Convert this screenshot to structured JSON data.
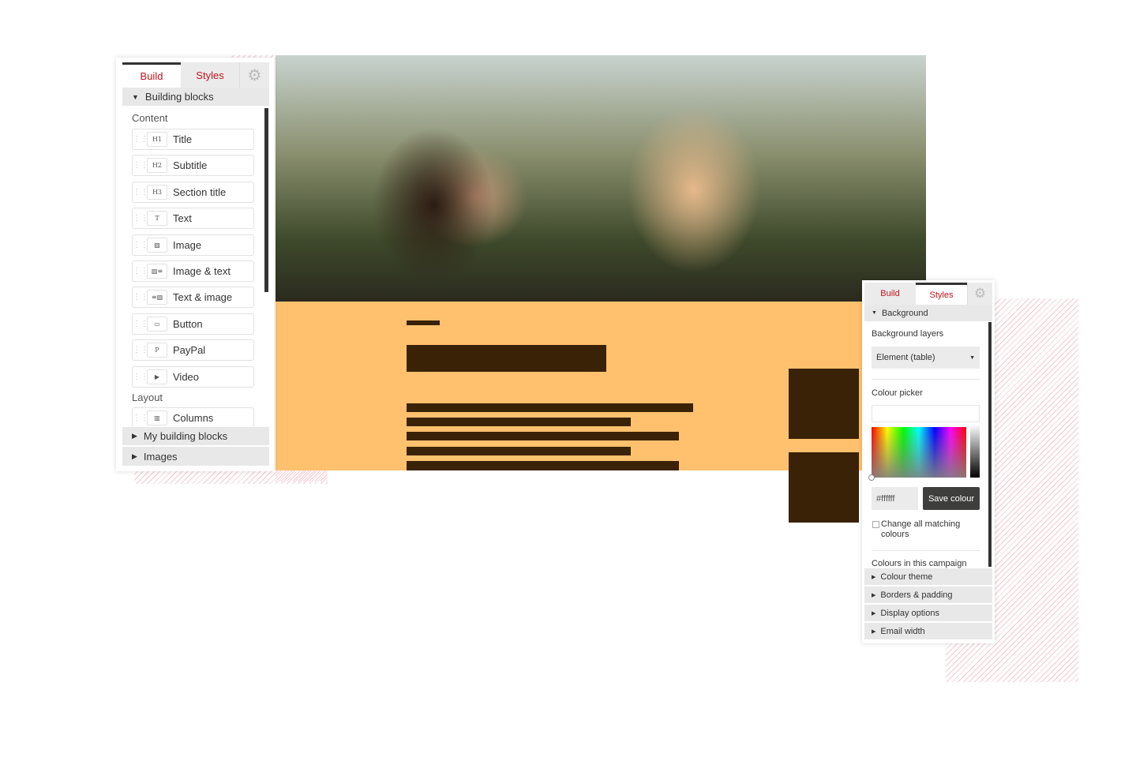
{
  "left_panel": {
    "tabs": [
      "Build",
      "Styles"
    ],
    "section": "Building blocks",
    "content_label": "Content",
    "items": [
      {
        "label": "Title",
        "icon": "H1"
      },
      {
        "label": "Subtitle",
        "icon": "H2"
      },
      {
        "label": "Section title",
        "icon": "H3"
      },
      {
        "label": "Text",
        "icon": "T"
      },
      {
        "label": "Image",
        "icon": "▨"
      },
      {
        "label": "Image & text",
        "icon": "▨≡"
      },
      {
        "label": "Text & image",
        "icon": "≡▨"
      },
      {
        "label": "Button",
        "icon": "▭"
      },
      {
        "label": "PayPal",
        "icon": "P"
      },
      {
        "label": "Video",
        "icon": "▶"
      }
    ],
    "layout_label": "Layout",
    "layout_items": [
      {
        "label": "Columns",
        "icon": "▥"
      }
    ],
    "collapsed": [
      "My building blocks",
      "Images"
    ]
  },
  "right_panel": {
    "tabs": [
      "Build",
      "Styles"
    ],
    "section": "Background",
    "bg_layers_label": "Background layers",
    "bg_layers_value": "Element (table)",
    "colour_picker_label": "Colour picker",
    "hex_value": "#ffffff",
    "save_label": "Save colour",
    "checkbox_label": "Change all matching colours",
    "campaign_colours_label": "Colours in this campaign",
    "collapsed": [
      "Colour theme",
      "Borders & padding",
      "Display options",
      "Email width"
    ]
  },
  "colors": {
    "accent": "#c0141c",
    "orange": "#ffc16e",
    "dark": "#3a2206"
  }
}
